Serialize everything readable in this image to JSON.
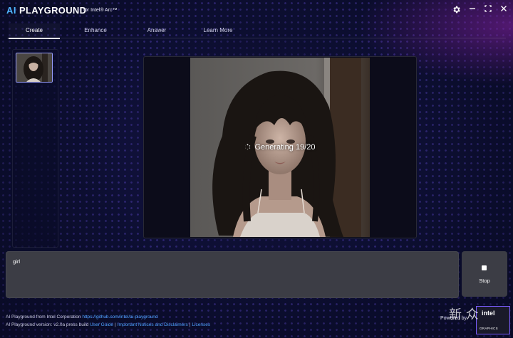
{
  "app": {
    "logo_ai": "AI",
    "logo_name": "PLAYGROUND",
    "logo_sub": "for Intel® Arc™"
  },
  "window_controls": {
    "settings_icon": "gear-icon",
    "minimize_icon": "minimize-icon",
    "maximize_icon": "maximize-icon",
    "close_icon": "close-icon"
  },
  "tabs": [
    {
      "label": "Create",
      "active": true
    },
    {
      "label": "Enhance",
      "active": false
    },
    {
      "label": "Answer",
      "active": false
    },
    {
      "label": "Learn More",
      "active": false
    }
  ],
  "viewer": {
    "status": "Generating 19/20"
  },
  "prompt": {
    "value": "girl"
  },
  "stop_button": {
    "label": "Stop"
  },
  "footer": {
    "line1_prefix": "AI Playground from Intel Corporation",
    "line1_link": "https://github.com/intel/ai-playground",
    "line2_prefix": "AI Playground version: v2.0a press build",
    "link_user_guide": "User Guide",
    "link_notices": "Important Notices and Disclaimers",
    "link_licenses": "Licenses",
    "powered_by": "Powered by"
  },
  "badge": {
    "brand": "intel",
    "sub": "GRAPHICS"
  },
  "watermark": "新 众"
}
